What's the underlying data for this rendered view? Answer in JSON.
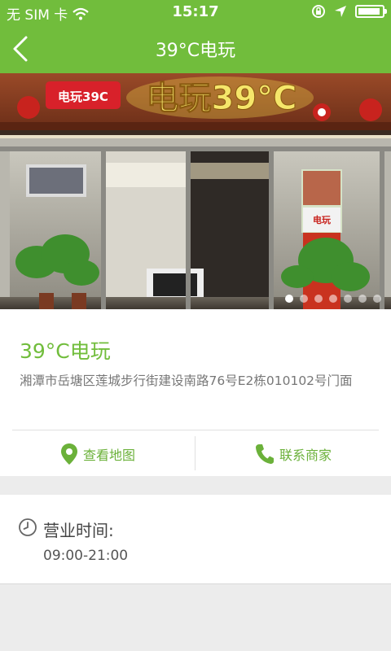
{
  "status_bar": {
    "carrier": "无 SIM 卡",
    "time": "15:17"
  },
  "nav": {
    "title": "39°C电玩"
  },
  "banner": {
    "sign_logo_text": "电玩39C",
    "sign_main_text": "电玩39°C",
    "poster_text": "电玩",
    "slide_count": 7,
    "active_slide": 1
  },
  "shop": {
    "name": "39°C电玩",
    "address": "湘潭市岳塘区莲城步行街建设南路76号E2栋010102号门面"
  },
  "actions": {
    "map_label": "查看地图",
    "call_label": "联系商家"
  },
  "hours": {
    "label": "营业时间:",
    "value": "09:00-21:00"
  },
  "colors": {
    "brand_green": "#71bd3c",
    "icon_green": "#6bb13a"
  }
}
